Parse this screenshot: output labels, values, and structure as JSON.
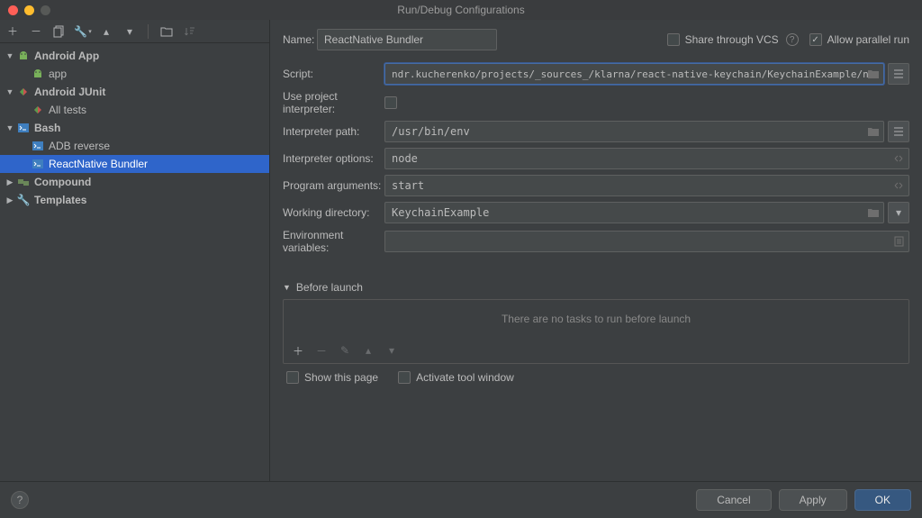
{
  "title": "Run/Debug Configurations",
  "tree": {
    "android_app": "Android App",
    "android_app_child": "app",
    "android_junit": "Android JUnit",
    "android_junit_child": "All tests",
    "bash": "Bash",
    "bash_child1": "ADB reverse",
    "bash_child2": "ReactNative Bundler",
    "compound": "Compound",
    "templates": "Templates"
  },
  "form": {
    "name_label": "Name:",
    "name_value": "ReactNative Bundler",
    "share_vcs": "Share through VCS",
    "allow_parallel": "Allow parallel run",
    "script_label": "Script:",
    "script_value": "ndr.kucherenko/projects/_sources_/klarna/react-native-keychain/KeychainExample/node_modules/.bin/react-native",
    "use_proj_interp": "Use project interpreter:",
    "interp_path_label": "Interpreter path:",
    "interp_path_value": "/usr/bin/env",
    "interp_opts_label": "Interpreter options:",
    "interp_opts_value": "node",
    "prog_args_label": "Program arguments:",
    "prog_args_value": "start",
    "workdir_label": "Working directory:",
    "workdir_value": "KeychainExample",
    "env_label": "Environment variables:",
    "env_value": ""
  },
  "before_launch": {
    "title": "Before launch",
    "empty": "There are no tasks to run before launch",
    "show_page": "Show this page",
    "activate_tool": "Activate tool window"
  },
  "buttons": {
    "cancel": "Cancel",
    "apply": "Apply",
    "ok": "OK"
  }
}
